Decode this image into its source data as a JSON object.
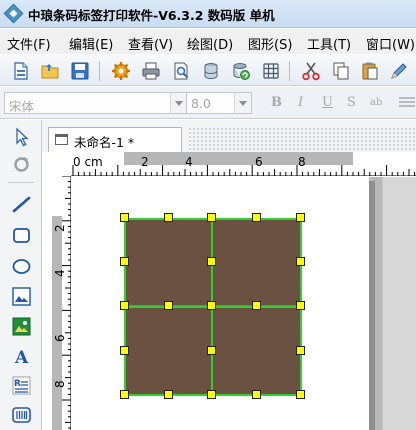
{
  "window": {
    "title": "中琅条码标签打印软件-V6.3.2 数码版 单机"
  },
  "menu": [
    {
      "label": "文件(F)"
    },
    {
      "label": "编辑(E)"
    },
    {
      "label": "查看(V)"
    },
    {
      "label": "绘图(D)"
    },
    {
      "label": "图形(S)"
    },
    {
      "label": "工具(T)"
    },
    {
      "label": "窗口(W)"
    }
  ],
  "toolbar": {
    "icons": [
      "new-file-icon",
      "open-folder-icon",
      "save-icon",
      "settings-gear-icon",
      "print-icon",
      "print-preview-icon",
      "database-icon",
      "database-refresh-icon",
      "grid-icon",
      "cut-icon",
      "copy-icon",
      "paste-icon",
      "pen-icon"
    ]
  },
  "format": {
    "font_value": "宋体",
    "size_value": "8.0",
    "bold": "B",
    "italic": "I",
    "underline": "U",
    "strike": "S",
    "spacing": "ab"
  },
  "palette": {
    "icons": [
      "select-arrow-icon",
      "rotate-icon",
      "line-icon",
      "rectangle-icon",
      "ellipse-icon",
      "image-icon",
      "picture-icon",
      "text-icon",
      "rich-text-icon",
      "barcode-icon"
    ]
  },
  "document": {
    "tab_title": "未命名-1 *"
  },
  "ruler": {
    "h_labels": [
      "0 cm",
      "2",
      "4",
      "6",
      "8"
    ],
    "v_labels": [
      "2",
      "4",
      "6",
      "8"
    ]
  },
  "shape": {
    "fill_color": "#6b5142",
    "line_color": "#2fd12f",
    "handle_color": "#ffff00"
  }
}
